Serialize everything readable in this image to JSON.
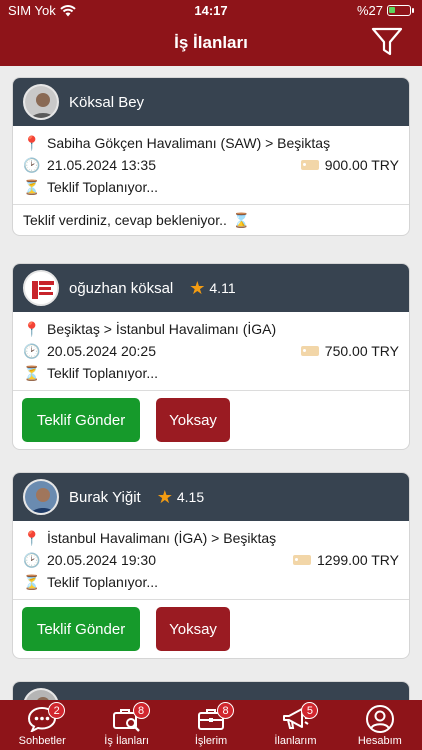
{
  "status": {
    "carrier": "SIM Yok",
    "time": "14:17",
    "battery": "%27"
  },
  "header": {
    "title": "İş İlanları"
  },
  "cards": [
    {
      "name": "Köksal Bey",
      "route": "Sabiha Gökçen Havalimanı (SAW) > Beşiktaş",
      "datetime": "21.05.2024 13:35",
      "price": "900.00 TRY",
      "state": "Teklif Toplanıyor...",
      "message": "Teklif verdiniz, cevap bekleniyor.."
    },
    {
      "name": "oğuzhan köksal",
      "rating": "4.11",
      "route": "Beşiktaş > İstanbul Havalimanı (İGA)",
      "datetime": "20.05.2024 20:25",
      "price": "750.00 TRY",
      "state": "Teklif Toplanıyor...",
      "send_label": "Teklif Gönder",
      "ignore_label": "Yoksay"
    },
    {
      "name": "Burak Yiğit",
      "rating": "4.15",
      "route": "İstanbul Havalimanı (İGA) > Beşiktaş",
      "datetime": "20.05.2024 19:30",
      "price": "1299.00 TRY",
      "state": "Teklif Toplanıyor...",
      "send_label": "Teklif Gönder",
      "ignore_label": "Yoksay"
    }
  ],
  "tabs": [
    {
      "label": "Sohbetler",
      "badge": "2",
      "icon": "chat-icon"
    },
    {
      "label": "İş İlanları",
      "badge": "8",
      "icon": "job-search-icon"
    },
    {
      "label": "İşlerim",
      "badge": "8",
      "icon": "briefcase-icon"
    },
    {
      "label": "İlanlarım",
      "badge": "5",
      "icon": "megaphone-icon"
    },
    {
      "label": "Hesabım",
      "icon": "account-icon"
    }
  ],
  "colors": {
    "brand": "#8e1419",
    "card_header": "#374350",
    "accept": "#169a2b",
    "reject": "#9a1b22",
    "star": "#f39c12"
  }
}
